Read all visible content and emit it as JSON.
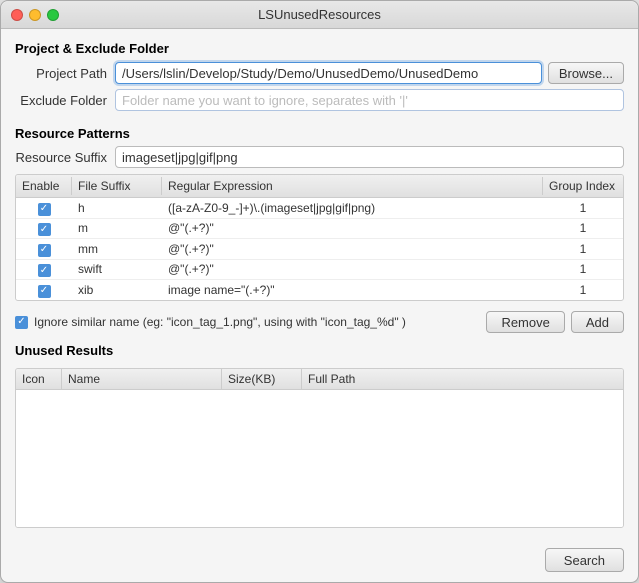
{
  "window": {
    "title": "LSUnusedResources"
  },
  "project_folder": {
    "section_title": "Project & Exclude Folder",
    "project_label": "Project Path",
    "project_value": "/Users/lslin/Develop/Study/Demo/UnusedDemo/UnusedDemo",
    "browse_label": "Browse...",
    "exclude_label": "Exclude Folder",
    "exclude_placeholder": "Folder name you want to ignore, separates with '|'"
  },
  "resource_patterns": {
    "section_title": "Resource Patterns",
    "suffix_label": "Resource Suffix",
    "suffix_value": "imageset|jpg|gif|png",
    "table_headers": [
      "Enable",
      "File Suffix",
      "Regular Expression",
      "Group Index"
    ],
    "rows": [
      {
        "enable": true,
        "suffix": "h",
        "regex": "([a-zA-Z0-9_-]+)\\.(imageset|jpg|gif|png)",
        "group": "1"
      },
      {
        "enable": true,
        "suffix": "m",
        "regex": "@\"(.+?)\"",
        "group": "1"
      },
      {
        "enable": true,
        "suffix": "mm",
        "regex": "@\"(.+?)\"",
        "group": "1"
      },
      {
        "enable": true,
        "suffix": "swift",
        "regex": "@\"(.+?)\"",
        "group": "1"
      },
      {
        "enable": true,
        "suffix": "xib",
        "regex": "image name=\"(.+?)\"",
        "group": "1"
      }
    ]
  },
  "ignore_row": {
    "label": "Ignore similar name (eg: \"icon_tag_1.png\", using with \"icon_tag_%d\" )",
    "remove_label": "Remove",
    "add_label": "Add"
  },
  "unused_results": {
    "section_title": "Unused Results",
    "headers": [
      "Icon",
      "Name",
      "Size(KB)",
      "Full Path"
    ]
  },
  "bottom": {
    "search_label": "Search"
  }
}
